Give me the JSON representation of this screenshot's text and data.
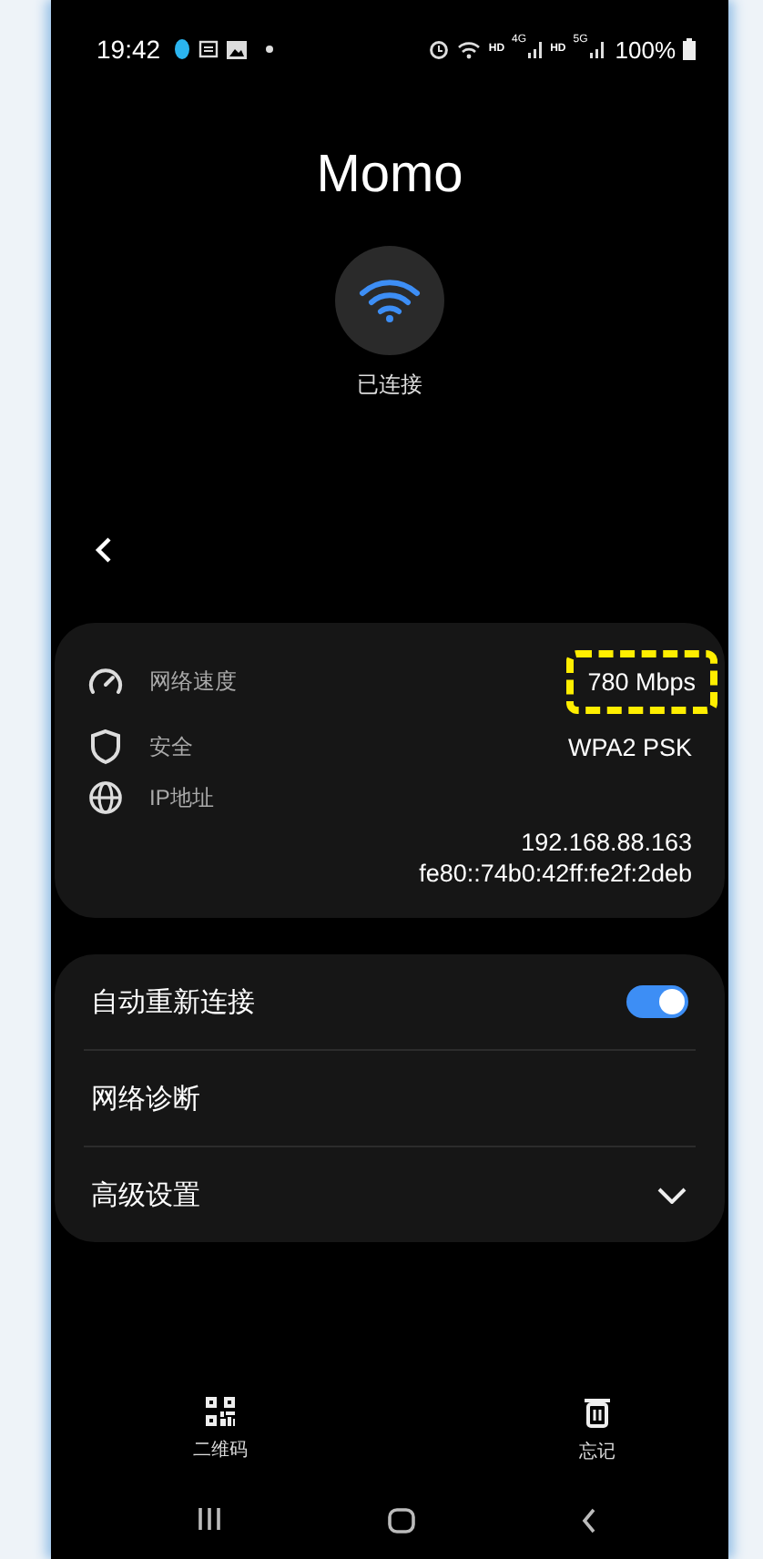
{
  "status_bar": {
    "time": "19:42",
    "network_labels": [
      "HD",
      "4G",
      "HD",
      "5G"
    ],
    "battery": "100%"
  },
  "network": {
    "name": "Momo",
    "status": "已连接"
  },
  "details": [
    {
      "kind": "speed",
      "label": "网络速度",
      "values": [
        "780 Mbps"
      ],
      "highlighted": true
    },
    {
      "kind": "security",
      "label": "安全",
      "values": [
        "WPA2 PSK"
      ],
      "highlighted": false
    },
    {
      "kind": "ip",
      "label": "IP地址",
      "values": [
        "192.168.88.163",
        "fe80::74b0:42ff:fe2f:2deb"
      ],
      "highlighted": false
    }
  ],
  "settings": [
    {
      "kind": "toggle",
      "label": "自动重新连接",
      "on": true
    },
    {
      "kind": "plain",
      "label": "网络诊断"
    },
    {
      "kind": "expander",
      "label": "高级设置",
      "expanded": false
    }
  ],
  "actions": [
    {
      "kind": "qr",
      "label": "二维码"
    },
    {
      "kind": "delete",
      "label": "忘记"
    }
  ]
}
